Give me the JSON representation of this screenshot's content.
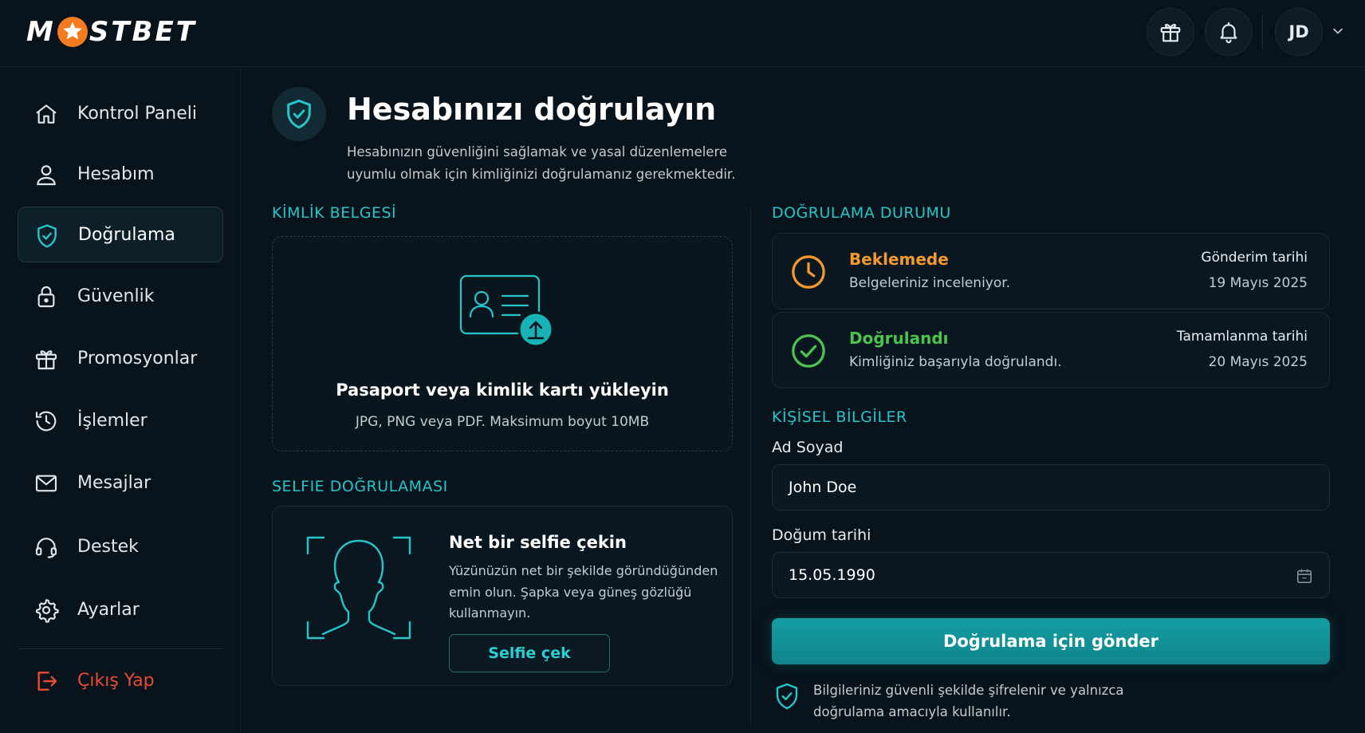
{
  "brand": {
    "name_left": "M",
    "name_right": "STBET",
    "accent": "#f47b20"
  },
  "header": {
    "gift_icon": "gift-icon",
    "bell_icon": "bell-icon",
    "avatar_initials": "JD"
  },
  "sidebar": {
    "items": [
      {
        "label": "Kontrol Paneli",
        "icon": "home-icon"
      },
      {
        "label": "Hesabım",
        "icon": "user-icon"
      },
      {
        "label": "Doğrulama",
        "icon": "shield-check-icon",
        "active": true
      },
      {
        "label": "Güvenlik",
        "icon": "lock-icon"
      },
      {
        "label": "Promosyonlar",
        "icon": "gift-icon"
      },
      {
        "label": "İşlemler",
        "icon": "history-icon"
      },
      {
        "label": "Mesajlar",
        "icon": "mail-icon"
      },
      {
        "label": "Destek",
        "icon": "headset-icon"
      },
      {
        "label": "Ayarlar",
        "icon": "gear-icon"
      }
    ],
    "logout_label": "Çıkış Yap"
  },
  "page": {
    "title": "Hesabınızı doğrulayın",
    "description": "Hesabınızın güvenliğini sağlamak ve yasal düzenlemelere uyumlu olmak için kimliğinizi doğrulamanız gerekmektedir."
  },
  "id_document": {
    "section_title": "KİMLİK BELGESİ",
    "upload_title": "Pasaport veya kimlik kartı yükleyin",
    "upload_hint": "JPG, PNG veya PDF. Maksimum boyut 10MB"
  },
  "selfie": {
    "section_title": "SELFIE DOĞRULAMASI",
    "title": "Net bir selfie çekin",
    "description": "Yüzünüzün net bir şekilde göründüğünden emin olun. Şapka veya güneş gözlüğü kullanmayın.",
    "button_label": "Selfie çek"
  },
  "verification_status": {
    "section_title": "DOĞRULAMA DURUMU",
    "items": [
      {
        "title": "Beklemede",
        "subtitle": "Belgeleriniz inceleniyor.",
        "date_label": "Gönderim tarihi",
        "date_value": "19 Mayıs 2025",
        "color": "#f29a2e",
        "icon": "clock-icon"
      },
      {
        "title": "Doğrulandı",
        "subtitle": "Kimliğiniz başarıyla doğrulandı.",
        "date_label": "Tamamlanma tarihi",
        "date_value": "20 Mayıs 2025",
        "color": "#4cc34f",
        "icon": "check-circle-icon"
      }
    ]
  },
  "personal_info": {
    "section_title": "KİŞİSEL BİLGİLER",
    "name_label": "Ad Soyad",
    "name_value": "John Doe",
    "dob_label": "Doğum tarihi",
    "dob_value": "15.05.1990",
    "submit_label": "Doğrulama için gönder",
    "security_note": "Bilgileriniz güvenli şekilde şifrelenir ve yalnızca doğrulama amacıyla kullanılır."
  },
  "colors": {
    "accent": "#26c5c9",
    "background": "#08131b",
    "danger": "#ea4b33"
  }
}
